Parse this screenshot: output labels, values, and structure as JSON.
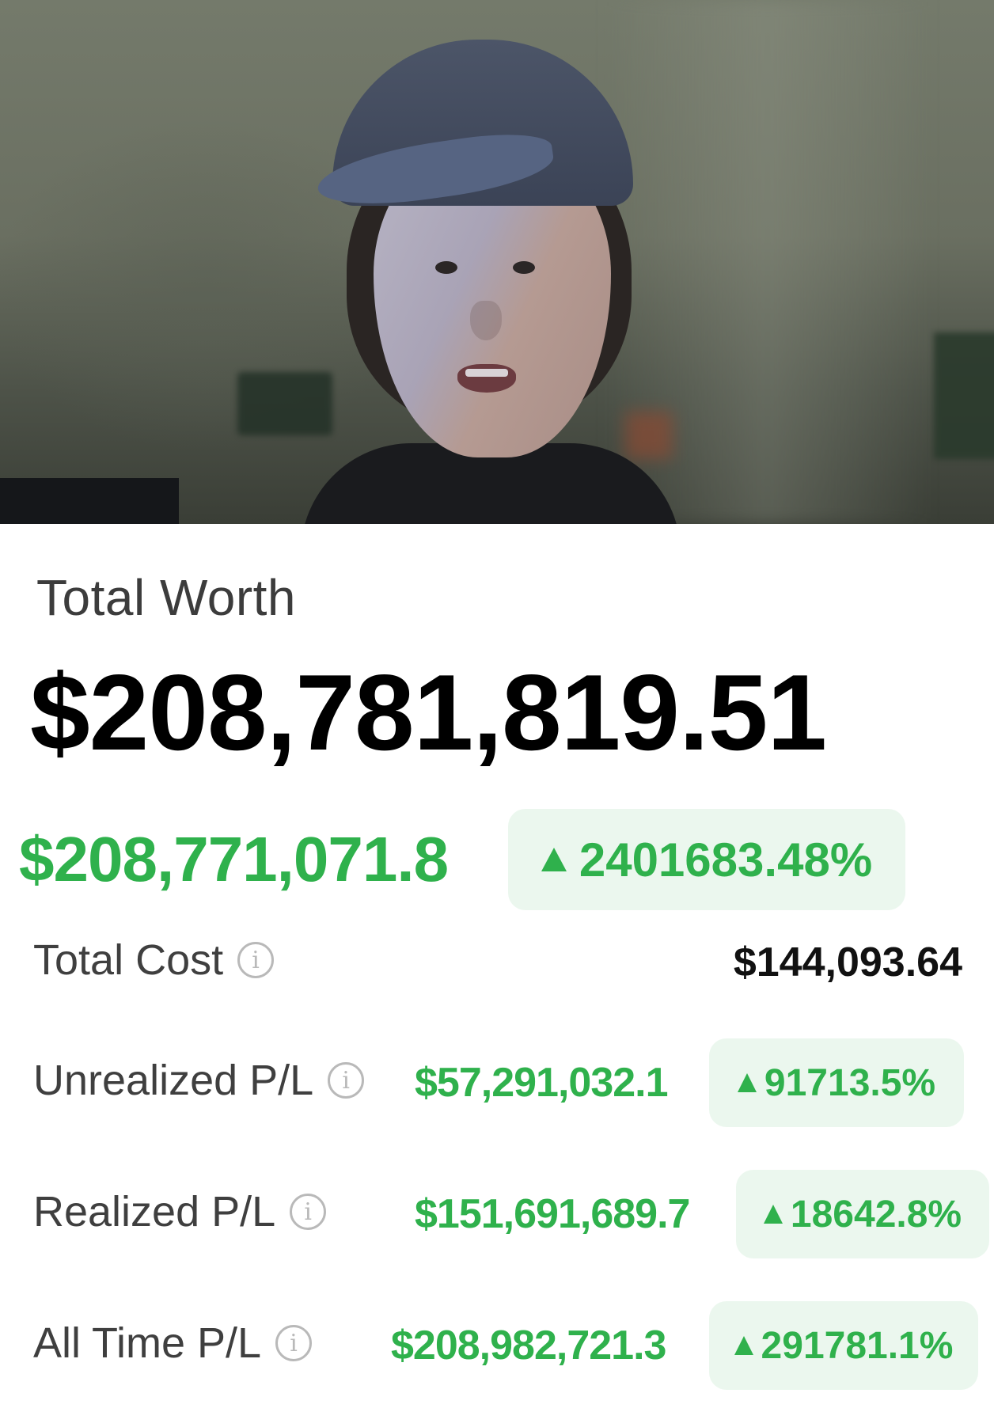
{
  "video": {
    "subject": "webcam-frame"
  },
  "portfolio": {
    "total_worth_label": "Total Worth",
    "total_worth_value": "$208,781,819.51",
    "gain_value": "$208,771,071.8",
    "gain_percent": "2401683.48%",
    "rows": [
      {
        "label": "Total Cost",
        "value": "$144,093.64"
      },
      {
        "label": "Unrealized P/L",
        "value": "$57,291,032.1",
        "percent": "91713.5%"
      },
      {
        "label": "Realized P/L",
        "value": "$151,691,689.7",
        "percent": "18642.8%"
      },
      {
        "label": "All Time P/L",
        "value": "$208,982,721.3",
        "percent": "291781.1%"
      }
    ],
    "info_glyph": "i"
  },
  "colors": {
    "gain_green": "#2fb14c",
    "badge_bg": "#ebf7ee",
    "text_dark": "#000000",
    "label_gray": "#3f3f3f",
    "icon_gray": "#b9b9b9"
  },
  "icons": [
    "info-icon",
    "up-triangle-icon"
  ]
}
